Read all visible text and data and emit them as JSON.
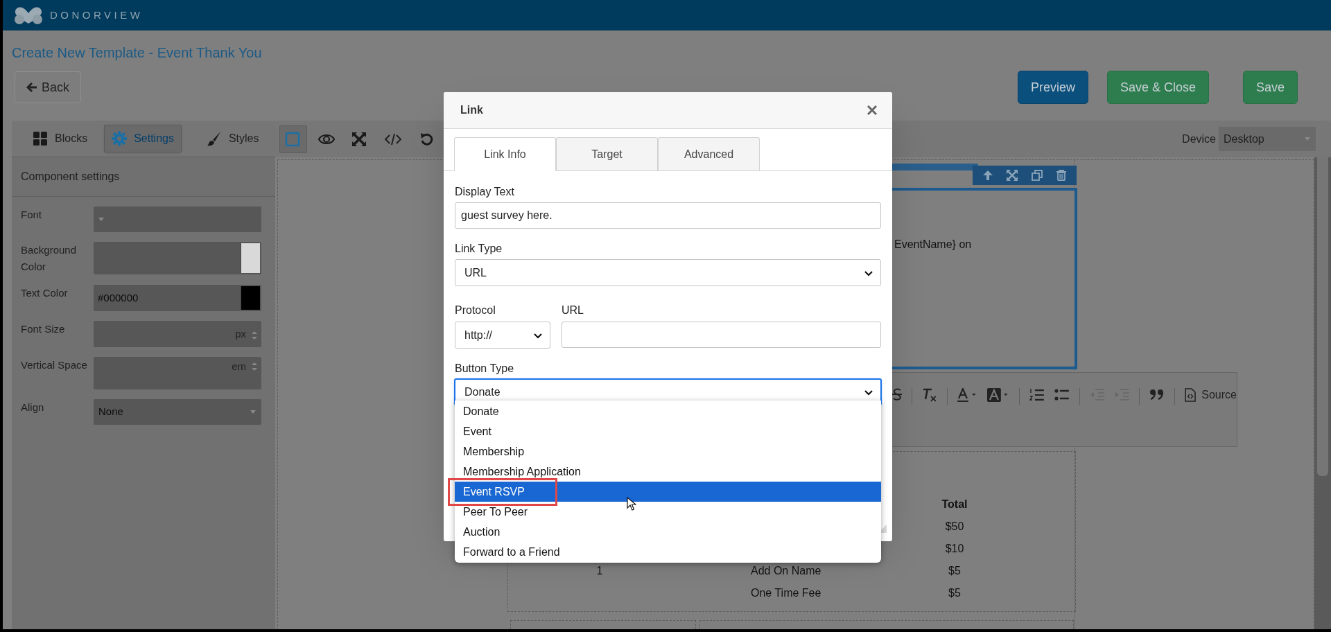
{
  "app_header": {
    "logo_text": "DONORVIEW"
  },
  "page": {
    "title": "Create New Template - Event Thank You",
    "back_button": "Back",
    "actions": [
      {
        "label": "Preview",
        "kind": "primary"
      },
      {
        "label": "Save & Close",
        "kind": "success"
      },
      {
        "label": "Save",
        "kind": "success"
      }
    ]
  },
  "left_panel": {
    "tabs": [
      {
        "label": "Blocks",
        "selected": false
      },
      {
        "label": "Settings",
        "selected": true
      },
      {
        "label": "Styles",
        "selected": false
      }
    ],
    "section_title": "Component settings",
    "fields": [
      {
        "kind": "select",
        "label": "Font"
      },
      {
        "kind": "color",
        "label": "Background Color",
        "color": "#d9d9d9"
      },
      {
        "kind": "color",
        "label": "Text Color",
        "value": "#000000",
        "color": "#000000"
      },
      {
        "kind": "number",
        "label": "Font Size",
        "unit": "px"
      },
      {
        "kind": "number",
        "label": "Vertical Space",
        "unit": "em"
      },
      {
        "kind": "select",
        "label": "Align",
        "value": "None"
      }
    ]
  },
  "canvas_toolbar": {
    "tools": [
      {
        "selected": true
      },
      {
        "selected": false
      },
      {
        "selected": false
      },
      {
        "selected": false
      },
      {
        "selected": false
      }
    ],
    "device_label": "Device",
    "device_value": "Desktop"
  },
  "canvas": {
    "text_block": "EventName} on",
    "editor_toolbar": {
      "source_button": "Source"
    },
    "table": {
      "total_heading": "Total",
      "rows": [
        {
          "total": "$50"
        },
        {
          "total": "$10"
        },
        {
          "column_1": "1",
          "column_2": "Add On Name",
          "total": "$5"
        },
        {
          "column_2": "One Time Fee",
          "total": "$5"
        }
      ]
    }
  },
  "dialog": {
    "title": "Link",
    "tabs": [
      {
        "label": "Link Info",
        "selected": true
      },
      {
        "label": "Target",
        "selected": false
      },
      {
        "label": "Advanced",
        "selected": false
      }
    ],
    "display_text": {
      "label": "Display Text",
      "value": "guest survey here."
    },
    "link_type": {
      "label": "Link Type",
      "value": "URL"
    },
    "protocol": {
      "label": "Protocol",
      "value": "http://"
    },
    "url": {
      "label": "URL"
    },
    "button_type": {
      "label": "Button Type",
      "value": "Donate",
      "options": [
        {
          "label": "Donate",
          "highlighted": false,
          "outlined": false
        },
        {
          "label": "Event",
          "highlighted": false,
          "outlined": false
        },
        {
          "label": "Membership",
          "highlighted": false,
          "outlined": false
        },
        {
          "label": "Membership Application",
          "highlighted": false,
          "outlined": false
        },
        {
          "label": "Event RSVP",
          "highlighted": true,
          "outlined": true
        },
        {
          "label": "Peer To Peer",
          "highlighted": false,
          "outlined": false
        },
        {
          "label": "Auction",
          "highlighted": false,
          "outlined": false
        },
        {
          "label": "Forward to a Friend",
          "highlighted": false,
          "outlined": false
        }
      ]
    }
  }
}
